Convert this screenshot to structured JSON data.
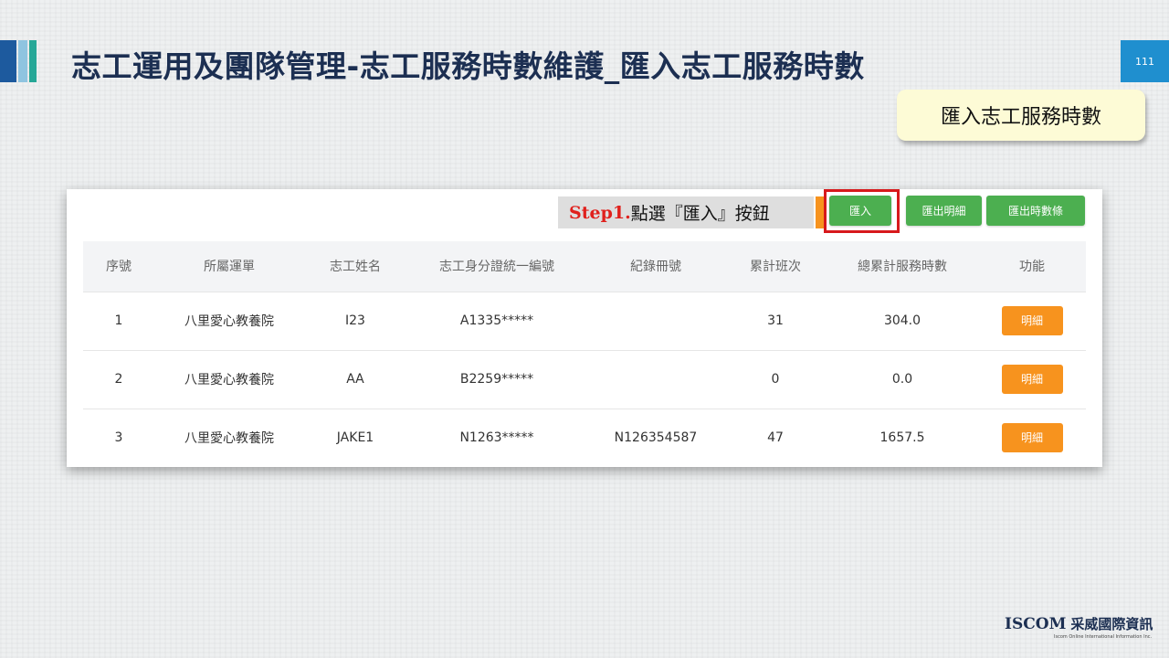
{
  "slide": {
    "title": "志工運用及團隊管理-志工服務時數維護_匯入志工服務時數",
    "page_number": "111",
    "callout": "匯入志工服務時數"
  },
  "step": {
    "prefix": "Step1.",
    "text": "點選『匯入』按鈕"
  },
  "toolbar": {
    "import_label": "匯入",
    "export_detail_label": "匯出明細",
    "export_hours_label": "匯出時數條"
  },
  "table": {
    "columns": [
      "序號",
      "所屬運單",
      "志工姓名",
      "志工身分證統一編號",
      "紀錄冊號",
      "累計班次",
      "總累計服務時數",
      "功能"
    ],
    "rows": [
      {
        "no": "1",
        "unit": "八里愛心教養院",
        "name": "I23",
        "id": "A1335*****",
        "record": "",
        "shifts": "31",
        "hours": "304.0",
        "action": "明細"
      },
      {
        "no": "2",
        "unit": "八里愛心教養院",
        "name": "AA",
        "id": "B2259*****",
        "record": "",
        "shifts": "0",
        "hours": "0.0",
        "action": "明細"
      },
      {
        "no": "3",
        "unit": "八里愛心教養院",
        "name": "JAKE1",
        "id": "N1263*****",
        "record": "N126354587",
        "shifts": "47",
        "hours": "1657.5",
        "action": "明細"
      }
    ]
  },
  "logo": {
    "brand": "ISCOM",
    "chinese_name": "采威國際資訊",
    "subtitle": "Iscom Online International Information Inc."
  },
  "colors": {
    "title": "#1c2f52",
    "primary_button": "#4caf50",
    "detail_button": "#f7931e",
    "highlight": "#d7191c",
    "page_badge": "#1f8fcf"
  }
}
